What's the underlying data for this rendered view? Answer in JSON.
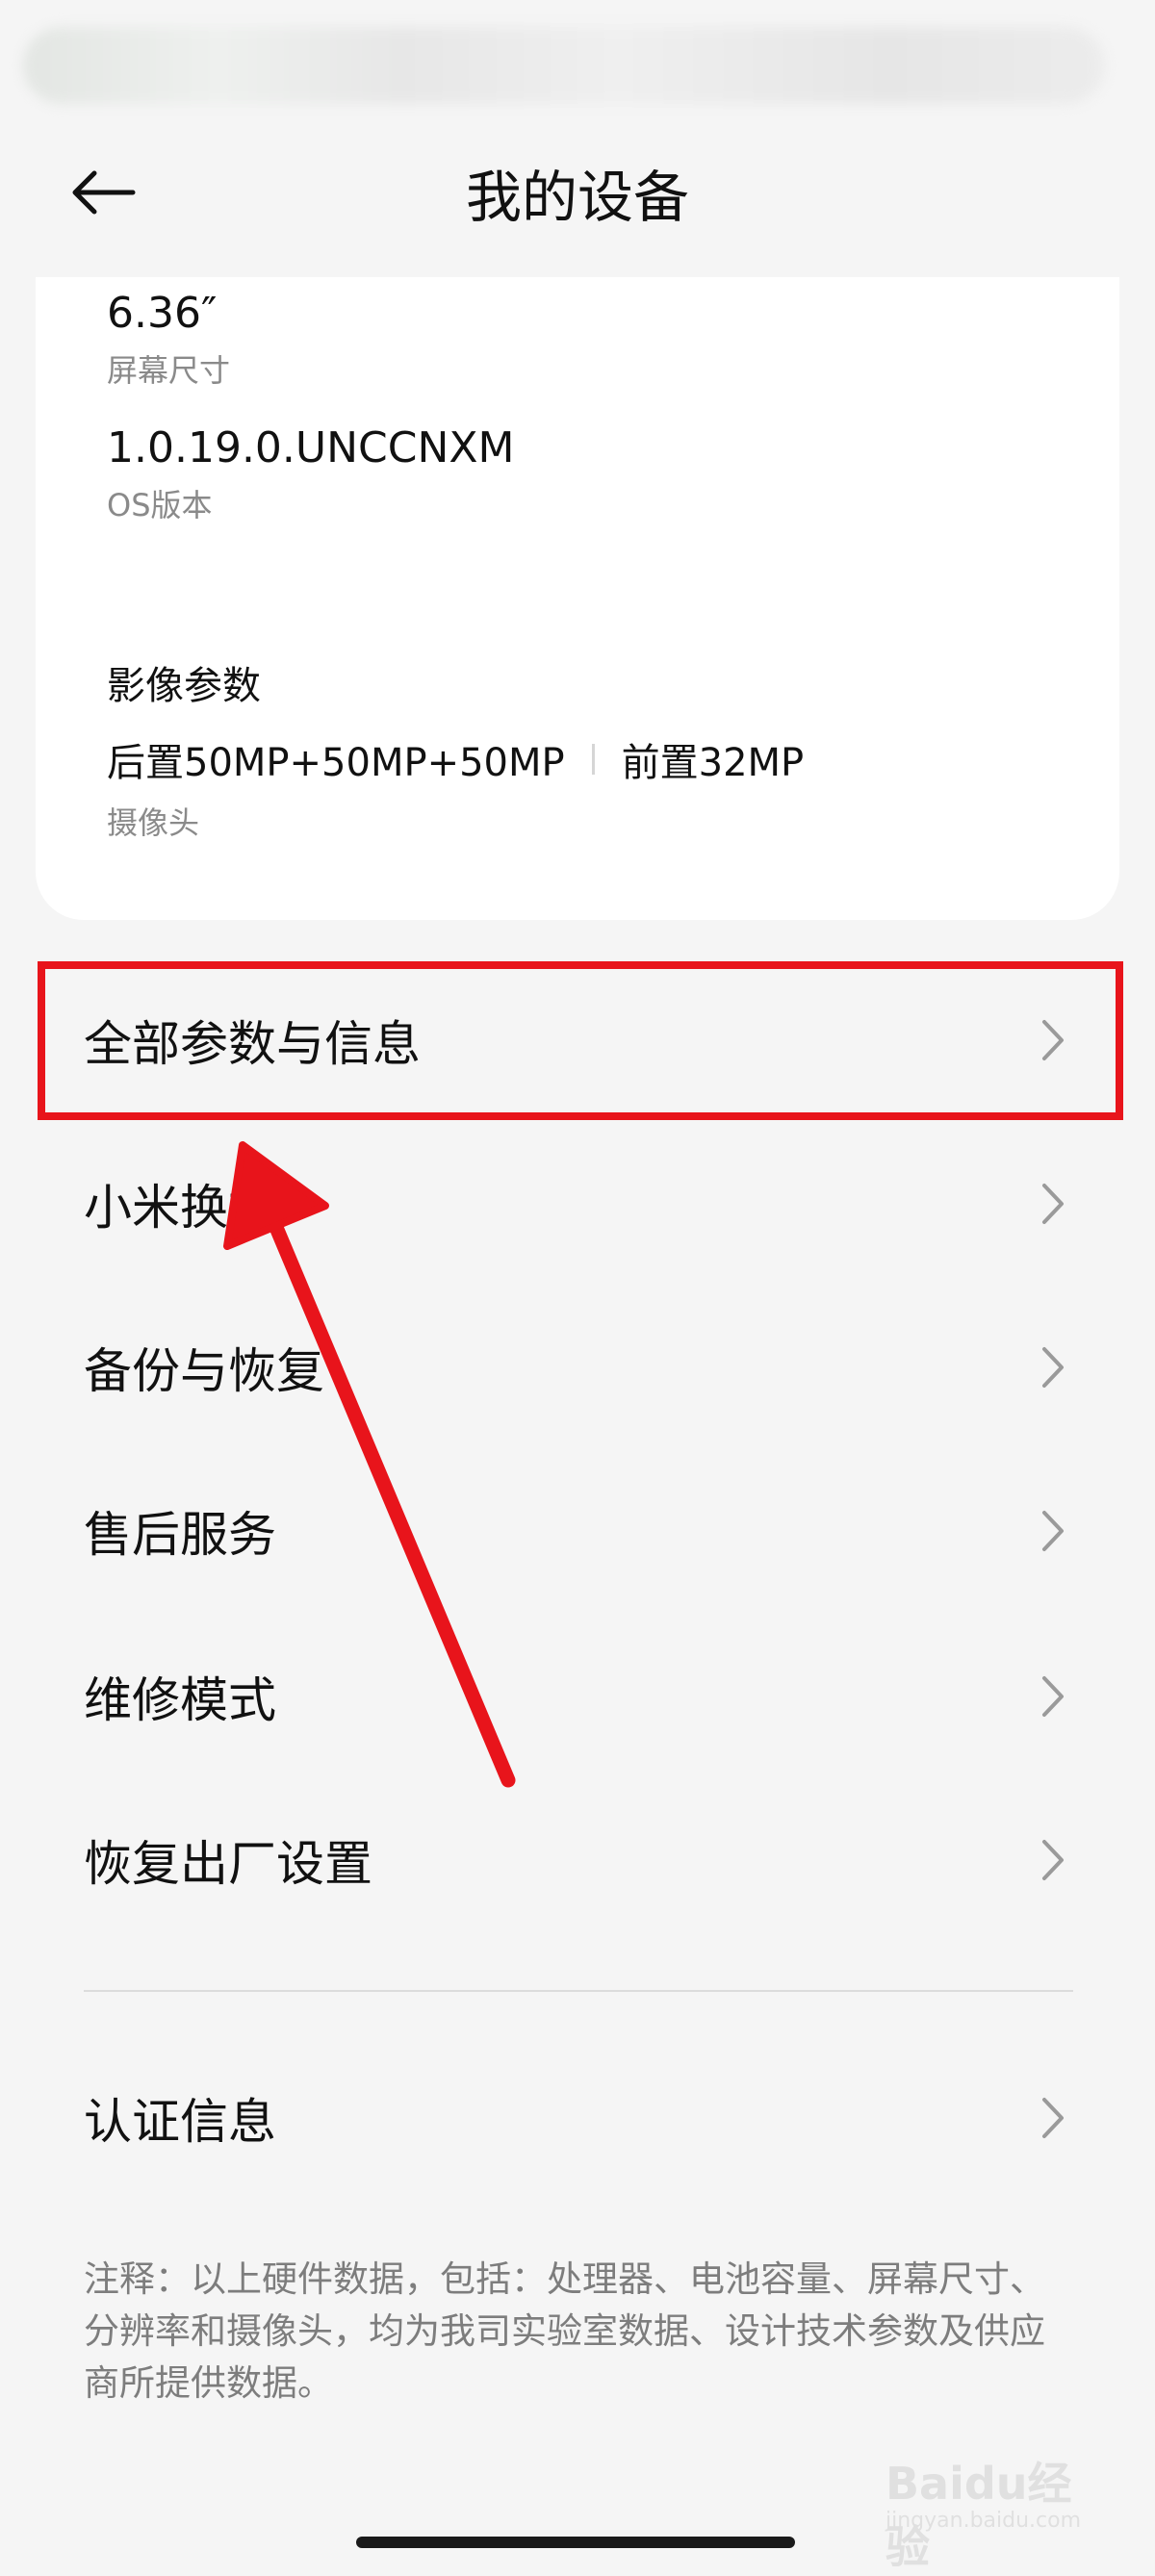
{
  "header": {
    "title": "我的设备"
  },
  "specs": {
    "screen_size_value": "6.36″",
    "screen_size_label": "屏幕尺寸",
    "os_value": "1.0.19.0.UNCCNXM",
    "os_label": "OS版本",
    "imaging_title": "影像参数",
    "rear_camera": "后置50MP+50MP+50MP",
    "front_camera": "前置32MP",
    "camera_label": "摄像头"
  },
  "menu": {
    "items": [
      {
        "label": "全部参数与信息"
      },
      {
        "label": "小米换机"
      },
      {
        "label": "备份与恢复"
      },
      {
        "label": "售后服务"
      },
      {
        "label": "维修模式"
      },
      {
        "label": "恢复出厂设置"
      },
      {
        "label": "认证信息"
      }
    ]
  },
  "footnote": "注释：以上硬件数据，包括：处理器、电池容量、屏幕尺寸、分辨率和摄像头，均为我司实验室数据、设计技术参数及供应商所提供数据。",
  "annotation": {
    "color": "#e8141b"
  },
  "watermark": {
    "logo": "Baidu经验",
    "url": "jingyan.baidu.com"
  }
}
